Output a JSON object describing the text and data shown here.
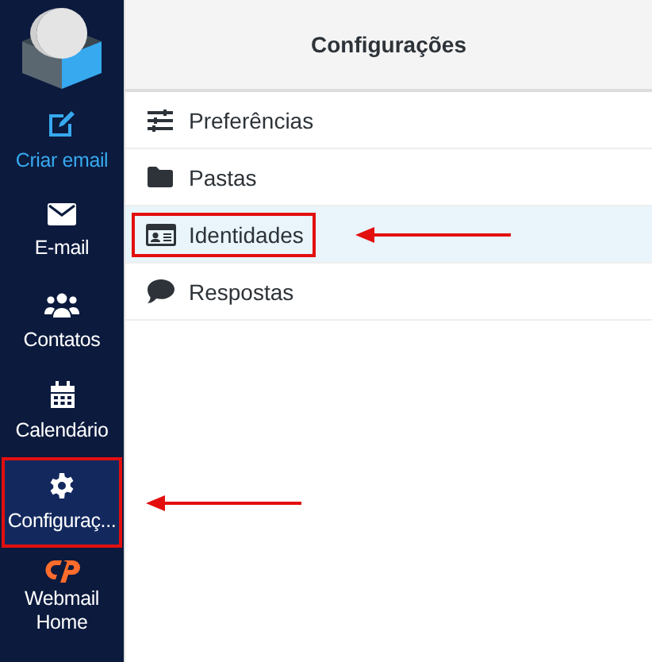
{
  "sidebar": {
    "items": [
      {
        "label": "Criar email",
        "kind": "compose",
        "selected": false,
        "highlighted": false
      },
      {
        "label": "E-mail",
        "kind": "nav",
        "selected": false,
        "highlighted": false
      },
      {
        "label": "Contatos",
        "kind": "nav",
        "selected": false,
        "highlighted": false
      },
      {
        "label": "Calendário",
        "kind": "nav",
        "selected": false,
        "highlighted": false
      },
      {
        "label": "Configuraç...",
        "kind": "nav",
        "selected": true,
        "highlighted": true
      },
      {
        "label": "Webmail Home",
        "kind": "cpanel",
        "selected": false,
        "highlighted": false
      }
    ]
  },
  "settings": {
    "title": "Configurações",
    "items": [
      {
        "label": "Preferências",
        "selected": false,
        "highlighted": false
      },
      {
        "label": "Pastas",
        "selected": false,
        "highlighted": false
      },
      {
        "label": "Identidades",
        "selected": true,
        "highlighted": true
      },
      {
        "label": "Respostas",
        "selected": false,
        "highlighted": false
      }
    ]
  }
}
